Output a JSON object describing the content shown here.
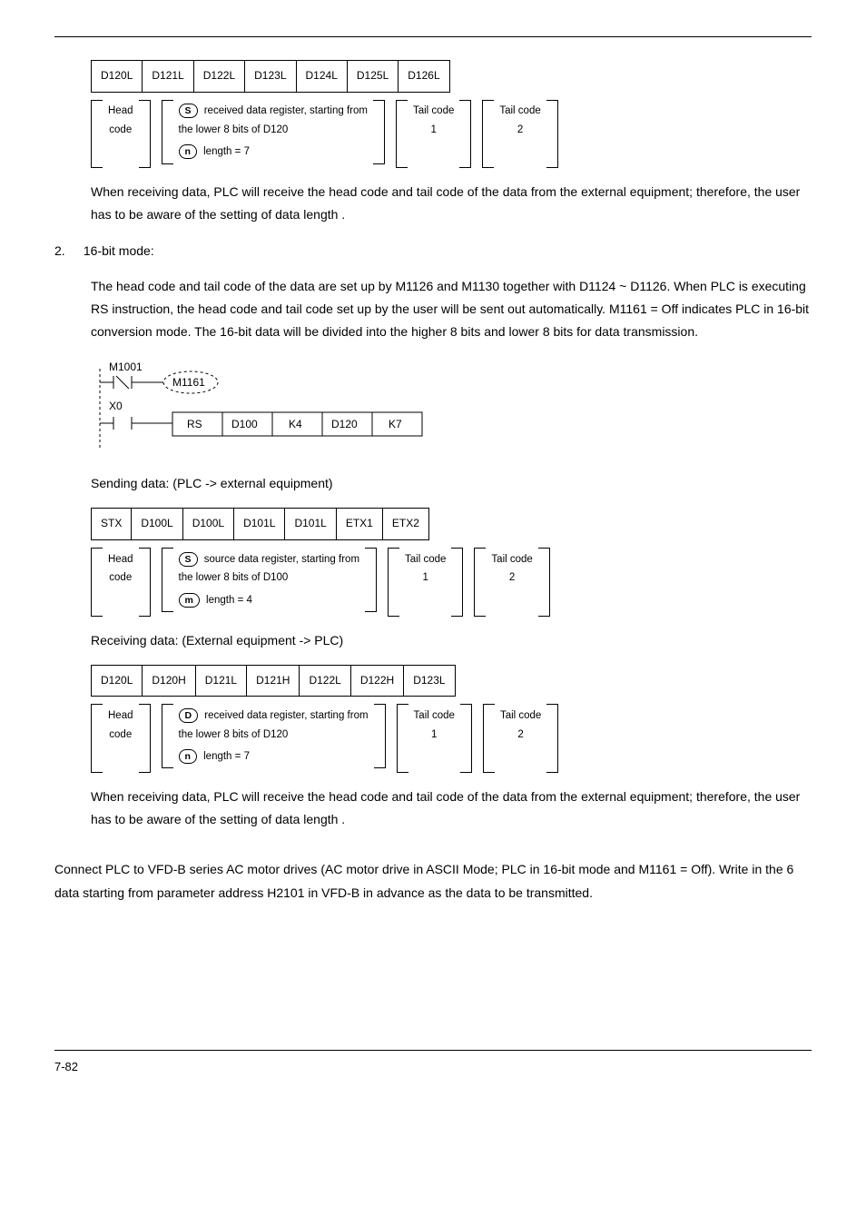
{
  "diag1": {
    "cells": [
      "D120L",
      "D121L",
      "D122L",
      "D123L",
      "D124L",
      "D125L",
      "D126L"
    ],
    "head": "Head\ncode",
    "s_letter": "S",
    "s_text": "received data register, starting from\nthe lower 8 bits of D120",
    "n_letter": "n",
    "n_text": "length = 7",
    "tail1": "Tail code\n1",
    "tail2": "Tail code\n2"
  },
  "para1": "When receiving data, PLC will receive the head code and tail code of the data from the external equipment; therefore, the user has to be aware of the setting of data length  .",
  "num2": "2.",
  "mode16_title": "16-bit mode:",
  "para2": "The head code and tail code of the data are set up by M1126 and M1130 together with D1124 ~ D1126. When PLC is executing RS instruction, the head code and tail code set up by the user will be sent out automatically. M1161 = Off indicates PLC in 16-bit conversion mode. The 16-bit data will be divided into the higher 8 bits and lower 8 bits for data transmission.",
  "ladder": {
    "m1001": "M1001",
    "m1161": "M1161",
    "x0": "X0",
    "cells": [
      "RS",
      "D100",
      "K4",
      "D120",
      "K7"
    ]
  },
  "send_label": "Sending data: (PLC -> external equipment)",
  "diag2": {
    "cells": [
      "STX",
      "D100L",
      "D100L",
      "D101L",
      "D101L",
      "ETX1",
      "ETX2"
    ],
    "head": "Head\ncode",
    "s_letter": "S",
    "s_text": "source data register, starting from\nthe lower 8 bits of D100",
    "m_letter": "m",
    "m_text": "length = 4",
    "tail1": "Tail code\n1",
    "tail2": "Tail code\n2"
  },
  "recv_label": "Receiving data: (External equipment -> PLC)",
  "diag3": {
    "cells": [
      "D120L",
      "D120H",
      "D121L",
      "D121H",
      "D122L",
      "D122H",
      "D123L"
    ],
    "head": "Head\ncode",
    "d_letter": "D",
    "d_text": "received data register, starting from\nthe lower 8 bits of D120",
    "n_letter": "n",
    "n_text": "length = 7",
    "tail1": "Tail code\n1",
    "tail2": "Tail code\n2"
  },
  "para3": "When receiving data, PLC will receive the head code and tail code of the data from the external equipment; therefore, the user has to be aware of the setting of data length  .",
  "para4": "Connect PLC to VFD-B series AC motor drives (AC motor drive in ASCII Mode; PLC in 16-bit mode and M1161 = Off). Write in the 6 data starting from parameter address H2101 in VFD-B in advance as the data to be transmitted.",
  "page_num": "7-82"
}
